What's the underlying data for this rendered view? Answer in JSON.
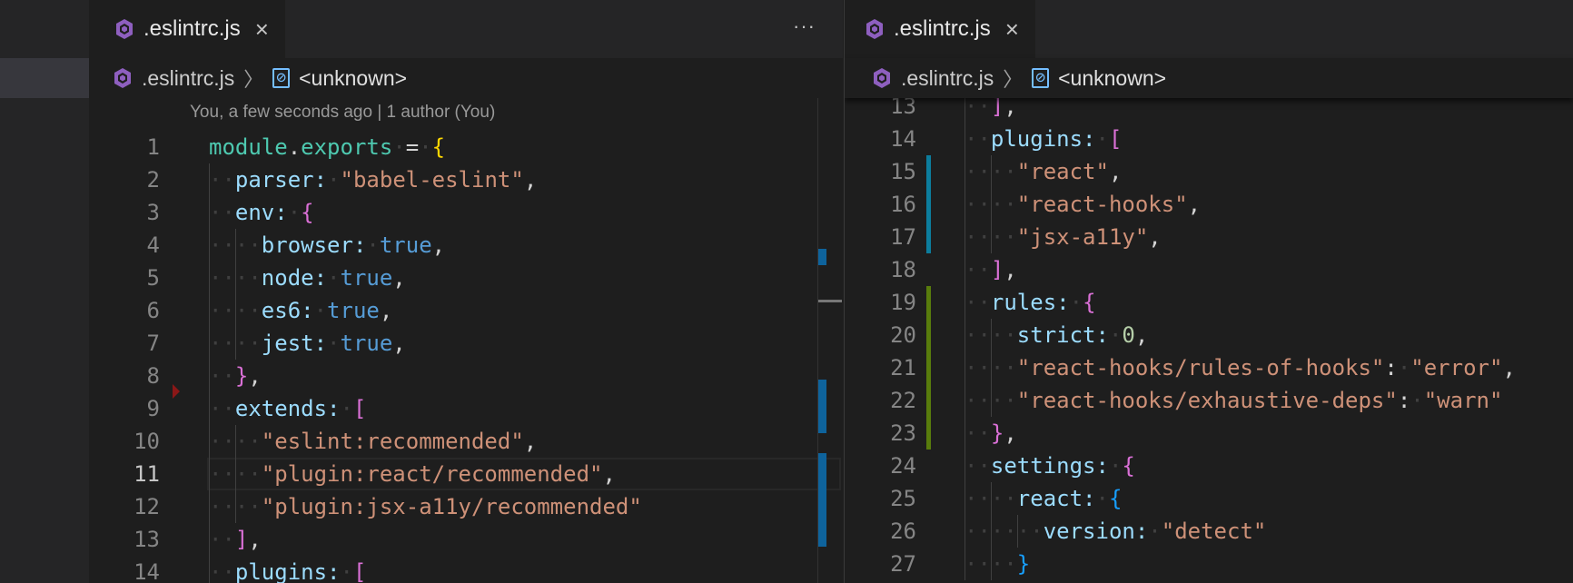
{
  "colors": {
    "modified": "#0c7d9d",
    "added": "#587c0c",
    "ruler": "#0e639c",
    "deleted": "#8b1717"
  },
  "left": {
    "tab": {
      "name": ".eslintrc.js",
      "close": "×",
      "icon": "eslint-icon"
    },
    "more": "···",
    "breadcrumb": {
      "file": ".eslintrc.js",
      "symbol_icon": "symbol-variable-icon",
      "symbol": "<unknown>"
    },
    "blame": "You, a few seconds ago | 1 author (You)",
    "current_line": 11,
    "lines": [
      {
        "n": 1,
        "indent": 0,
        "tokens": [
          [
            "module",
            "var"
          ],
          [
            ".",
            "p"
          ],
          [
            "exports",
            "var"
          ],
          [
            " = ",
            "p"
          ],
          [
            "{",
            "brace"
          ]
        ]
      },
      {
        "n": 2,
        "indent": 2,
        "tokens": [
          [
            "parser:",
            "key"
          ],
          [
            " ",
            "p"
          ],
          [
            "\"babel-eslint\"",
            "str"
          ],
          [
            ",",
            "p"
          ]
        ]
      },
      {
        "n": 3,
        "indent": 2,
        "tokens": [
          [
            "env:",
            "key"
          ],
          [
            " ",
            "p"
          ],
          [
            "{",
            "pink"
          ]
        ]
      },
      {
        "n": 4,
        "indent": 4,
        "tokens": [
          [
            "browser:",
            "key"
          ],
          [
            " ",
            "p"
          ],
          [
            "true",
            "bool"
          ],
          [
            ",",
            "p"
          ]
        ]
      },
      {
        "n": 5,
        "indent": 4,
        "tokens": [
          [
            "node:",
            "key"
          ],
          [
            " ",
            "p"
          ],
          [
            "true",
            "bool"
          ],
          [
            ",",
            "p"
          ]
        ]
      },
      {
        "n": 6,
        "indent": 4,
        "tokens": [
          [
            "es6:",
            "key"
          ],
          [
            " ",
            "p"
          ],
          [
            "true",
            "bool"
          ],
          [
            ",",
            "p"
          ]
        ]
      },
      {
        "n": 7,
        "indent": 4,
        "tokens": [
          [
            "jest:",
            "key"
          ],
          [
            " ",
            "p"
          ],
          [
            "true",
            "bool"
          ],
          [
            ",",
            "p"
          ]
        ]
      },
      {
        "n": 8,
        "indent": 2,
        "tokens": [
          [
            "}",
            "pink"
          ],
          [
            ",",
            "p"
          ]
        ]
      },
      {
        "n": 9,
        "indent": 2,
        "tokens": [
          [
            "extends:",
            "key"
          ],
          [
            " ",
            "p"
          ],
          [
            "[",
            "pink"
          ]
        ]
      },
      {
        "n": 10,
        "indent": 4,
        "tokens": [
          [
            "\"eslint:recommended\"",
            "str"
          ],
          [
            ",",
            "p"
          ]
        ]
      },
      {
        "n": 11,
        "indent": 4,
        "tokens": [
          [
            "\"plugin:react/recommended\"",
            "str"
          ],
          [
            ",",
            "p"
          ]
        ]
      },
      {
        "n": 12,
        "indent": 4,
        "tokens": [
          [
            "\"plugin:jsx-a11y/recommended\"",
            "str"
          ]
        ]
      },
      {
        "n": 13,
        "indent": 2,
        "tokens": [
          [
            "]",
            "pink"
          ],
          [
            ",",
            "p"
          ]
        ]
      },
      {
        "n": 14,
        "indent": 2,
        "tokens": [
          [
            "plugins:",
            "key"
          ],
          [
            " ",
            "p"
          ],
          [
            "[",
            "pink"
          ]
        ]
      }
    ]
  },
  "right": {
    "tab": {
      "name": ".eslintrc.js",
      "close": "×",
      "icon": "eslint-icon"
    },
    "breadcrumb": {
      "file": ".eslintrc.js",
      "symbol_icon": "symbol-variable-icon",
      "symbol": "<unknown>"
    },
    "lines": [
      {
        "n": 13,
        "indent": 2,
        "tokens": [
          [
            "]",
            "pink"
          ],
          [
            ",",
            "p"
          ]
        ]
      },
      {
        "n": 14,
        "indent": 2,
        "tokens": [
          [
            "plugins:",
            "key"
          ],
          [
            " ",
            "p"
          ],
          [
            "[",
            "pink"
          ]
        ]
      },
      {
        "n": 15,
        "indent": 4,
        "tokens": [
          [
            "\"react\"",
            "str"
          ],
          [
            ",",
            "p"
          ]
        ]
      },
      {
        "n": 16,
        "indent": 4,
        "tokens": [
          [
            "\"react-hooks\"",
            "str"
          ],
          [
            ",",
            "p"
          ]
        ]
      },
      {
        "n": 17,
        "indent": 4,
        "tokens": [
          [
            "\"jsx-a11y\"",
            "str"
          ],
          [
            ",",
            "p"
          ]
        ]
      },
      {
        "n": 18,
        "indent": 2,
        "tokens": [
          [
            "]",
            "pink"
          ],
          [
            ",",
            "p"
          ]
        ]
      },
      {
        "n": 19,
        "indent": 2,
        "tokens": [
          [
            "rules:",
            "key"
          ],
          [
            " ",
            "p"
          ],
          [
            "{",
            "pink"
          ]
        ]
      },
      {
        "n": 20,
        "indent": 4,
        "tokens": [
          [
            "strict:",
            "key"
          ],
          [
            " ",
            "p"
          ],
          [
            "0",
            "num"
          ],
          [
            ",",
            "p"
          ]
        ]
      },
      {
        "n": 21,
        "indent": 4,
        "tokens": [
          [
            "\"react-hooks/rules-of-hooks\"",
            "str"
          ],
          [
            ": ",
            "p"
          ],
          [
            "\"error\"",
            "str"
          ],
          [
            ",",
            "p"
          ]
        ]
      },
      {
        "n": 22,
        "indent": 4,
        "tokens": [
          [
            "\"react-hooks/exhaustive-deps\"",
            "str"
          ],
          [
            ": ",
            "p"
          ],
          [
            "\"warn\"",
            "str"
          ]
        ]
      },
      {
        "n": 23,
        "indent": 2,
        "tokens": [
          [
            "}",
            "pink"
          ],
          [
            ",",
            "p"
          ]
        ]
      },
      {
        "n": 24,
        "indent": 2,
        "tokens": [
          [
            "settings:",
            "key"
          ],
          [
            " ",
            "p"
          ],
          [
            "{",
            "pink"
          ]
        ]
      },
      {
        "n": 25,
        "indent": 4,
        "tokens": [
          [
            "react:",
            "key"
          ],
          [
            " ",
            "p"
          ],
          [
            "{",
            "blue"
          ]
        ]
      },
      {
        "n": 26,
        "indent": 6,
        "tokens": [
          [
            "version:",
            "key"
          ],
          [
            " ",
            "p"
          ],
          [
            "\"detect\"",
            "str"
          ]
        ]
      },
      {
        "n": 27,
        "indent": 4,
        "tokens": [
          [
            "}",
            "blue"
          ]
        ]
      }
    ],
    "gutter": [
      {
        "from": 15,
        "to": 17,
        "type": "modified"
      },
      {
        "from": 19,
        "to": 23,
        "type": "added"
      }
    ]
  }
}
